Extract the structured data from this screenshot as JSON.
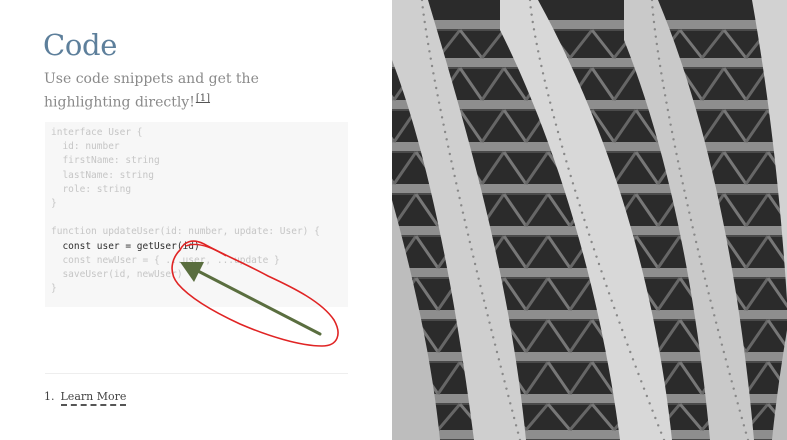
{
  "header": {
    "title": "Code",
    "subtitle": "Use code snippets and get the highlighting directly!",
    "footnote_ref": "[1]"
  },
  "code": {
    "lines": [
      {
        "text": "interface User {",
        "highlight": false
      },
      {
        "text": "  id: number",
        "highlight": false
      },
      {
        "text": "  firstName: string",
        "highlight": false
      },
      {
        "text": "  lastName: string",
        "highlight": false
      },
      {
        "text": "  role: string",
        "highlight": false
      },
      {
        "text": "}",
        "highlight": false
      },
      {
        "text": "",
        "highlight": false
      },
      {
        "text": "function updateUser(id: number, update: User) {",
        "highlight": false
      },
      {
        "text": "  const user = getUser(id)",
        "highlight": true
      },
      {
        "text": "  const newUser = { ...user, ...update }",
        "highlight": false
      },
      {
        "text": "  saveUser(id, newUser)",
        "highlight": false
      },
      {
        "text": "}",
        "highlight": false
      }
    ]
  },
  "footnotes": {
    "items": [
      {
        "number": "1.",
        "label": "Learn More"
      }
    ]
  },
  "colors": {
    "title": "#5d7f9b",
    "annotation_circle": "#e02424",
    "annotation_arrow": "#5a6e3f",
    "code_background": "#f7f7f7"
  },
  "image": {
    "subject": "steel bridge underside"
  }
}
